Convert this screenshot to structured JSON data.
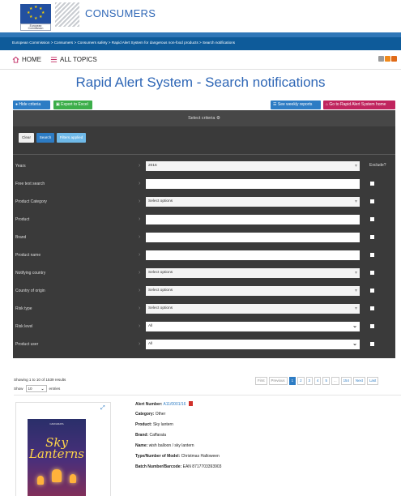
{
  "header": {
    "eu_caption_line1": "European",
    "eu_caption_line2": "Commission",
    "site_name": "CONSUMERS"
  },
  "breadcrumb": {
    "items": [
      "European Commission",
      "Consumers",
      "Consumers safety",
      "Rapid Alert System for dangerous non-food products",
      "Search notifications"
    ]
  },
  "topnav": {
    "home_label": "HOME",
    "topics_label": "ALL TOPICS"
  },
  "page_title": "Rapid Alert System - Search notifications",
  "actions": {
    "hide_criteria": "Hide criteria",
    "export_excel": "Export to Excel",
    "weekly_reports": "See weekly reports",
    "go_home": "Go to Rapid Alert System home"
  },
  "criteria": {
    "header": "Select criteria",
    "clear": "Clear",
    "search": "Search",
    "filters_applied": "Filters applied",
    "exclude_header": "Exclude?",
    "rows": [
      {
        "label": "Years",
        "value": "2016"
      },
      {
        "label": "Free text search",
        "value": ""
      },
      {
        "label": "Product Category",
        "value": "Select options"
      },
      {
        "label": "Product",
        "value": ""
      },
      {
        "label": "Brand",
        "value": ""
      },
      {
        "label": "Product name",
        "value": ""
      },
      {
        "label": "Notifying country",
        "value": "Select options"
      },
      {
        "label": "Country of origin",
        "value": "Select options"
      },
      {
        "label": "Risk type",
        "value": "Select options"
      },
      {
        "label": "Risk level",
        "value": "All"
      },
      {
        "label": "Product user",
        "value": "All"
      }
    ]
  },
  "results": {
    "info": "Showing 1 to 10 of 1539 results",
    "show_label": "Show",
    "show_value": "10",
    "entries_label": "entries",
    "pagination": [
      "First",
      "Previous",
      "1",
      "2",
      "3",
      "4",
      "5",
      "...",
      "154",
      "Next",
      "Last"
    ],
    "active_page": "1"
  },
  "alert": {
    "number_label": "Alert Number:",
    "number_value": "A11/0001/16",
    "category_label": "Category:",
    "category_value": "Other",
    "product_label": "Product:",
    "product_value": "Sky lantern",
    "brand_label": "Brand:",
    "brand_value": "Caffarata",
    "name_label": "Name:",
    "name_value": "wish balloon / sky lantern",
    "model_label": "Type/Number of Model:",
    "model_value": "Christmas Halloween",
    "batch_label": "Batch Number/Barcode:",
    "batch_value": "EAN 8717703393903"
  },
  "thumbnail": {
    "brand_text": "CAFFARATA",
    "title_line1": "Sky",
    "title_line2": "Lanterns"
  },
  "colors": {
    "brand_blue": "#2f67b6",
    "bar_blue": "#0e5b9a",
    "action_blue": "#2d7cc4",
    "export_green": "#3cae4a",
    "home_magenta": "#c0245e",
    "panel_dark": "#3a3a3a"
  }
}
